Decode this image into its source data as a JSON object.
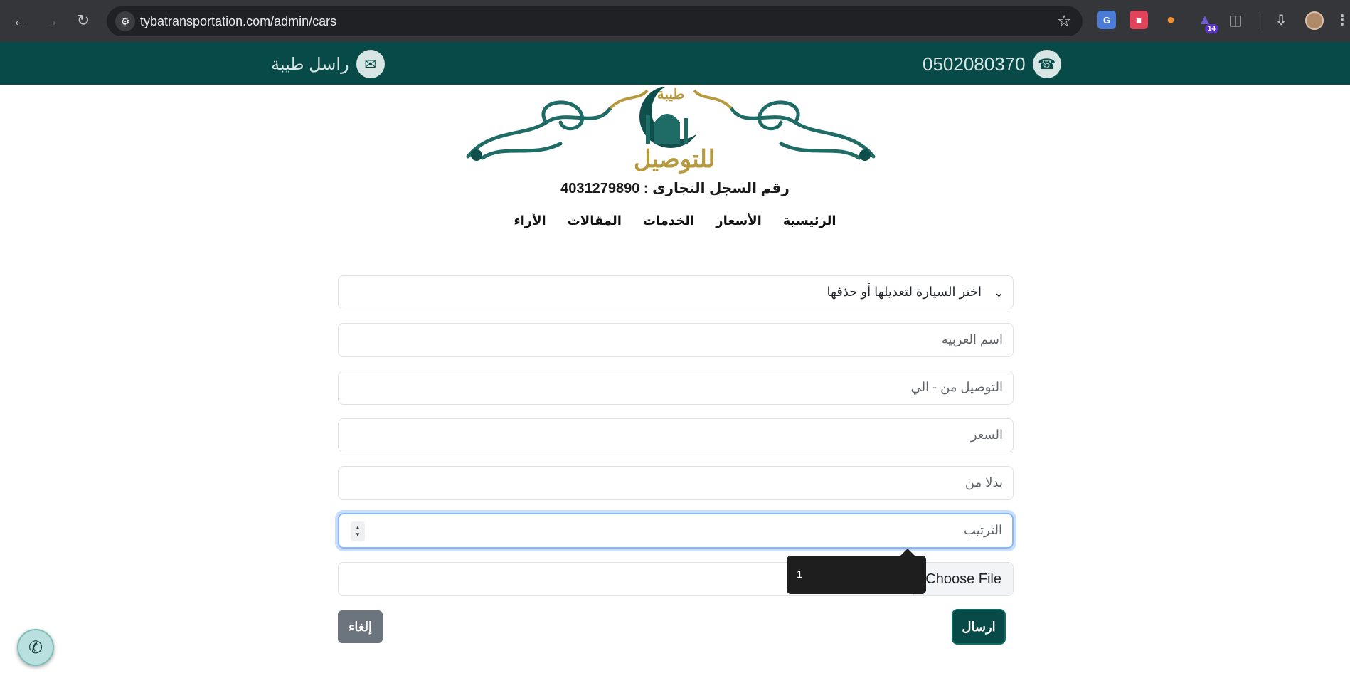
{
  "browser": {
    "url": "tybatransportation.com/admin/cars",
    "extension_badge": "14"
  },
  "topbar": {
    "phone": "0502080370",
    "contact_label": "راسل طيبة"
  },
  "logo": {
    "word": "للتوصيل",
    "top_word": "طيبة"
  },
  "registration": "رقم السجل التجارى : 4031279890",
  "menu": [
    "الرئيسية",
    "الأسعار",
    "الخدمات",
    "المقالات",
    "الأراء"
  ],
  "form": {
    "select_placeholder": "اختر السيارة لتعديلها أو حذفها",
    "car_name_placeholder": "اسم العربيه",
    "route_placeholder": "التوصيل من - الي",
    "price_placeholder": "السعر",
    "instead_of_placeholder": "بدلا من",
    "order_placeholder": "الترتيب",
    "file_button": "Choose File",
    "tooltip_value": "1",
    "submit_label": "ارسال",
    "cancel_label": "إلغاء"
  },
  "colors": {
    "brand_teal": "#074a47",
    "gold": "#b89a3e"
  }
}
